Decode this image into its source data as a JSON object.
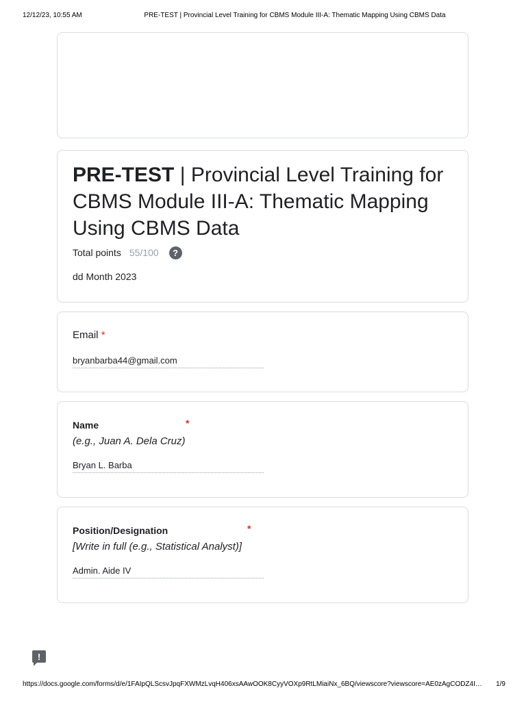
{
  "print_header": {
    "datetime": "12/12/23, 10:55 AM",
    "title": "PRE-TEST | Provincial Level Training for CBMS Module III-A: Thematic Mapping Using CBMS Data"
  },
  "form": {
    "title_bold": "PRE-TEST",
    "title_rest": " | Provincial Level Training for CBMS Module III-A: Thematic Mapping Using CBMS Data",
    "total_points_label": "Total points",
    "score": "55/100",
    "help_icon": "?",
    "date": "dd Month 2023"
  },
  "questions": {
    "email": {
      "label": "Email",
      "required_mark": "*",
      "answer": "bryanbarba44@gmail.com"
    },
    "name": {
      "label": "Name",
      "required_mark": "*",
      "description": "(e.g., Juan A. Dela Cruz)",
      "answer": "Bryan L. Barba"
    },
    "position": {
      "label": "Position/Designation",
      "required_mark": "*",
      "description": "[Write in full (e.g., Statistical Analyst)]",
      "answer": "Admin. Aide IV"
    }
  },
  "feedback_icon": "!",
  "print_footer": {
    "url": "https://docs.google.com/forms/d/e/1FAIpQLScsvJpqFXWMzLvqH406xsAAwOOK8CyyVOXp9RtLMiaiNx_6BQ/viewscore?viewscore=AE0zAgCODZ4I…",
    "page": "1/9"
  },
  "icons": {
    "help": "help-circle-icon",
    "feedback": "report-feedback-icon"
  },
  "colors": {
    "required": "#d93025",
    "border": "#dadce0",
    "muted": "#9aa0a6",
    "icon": "#5f6368"
  }
}
